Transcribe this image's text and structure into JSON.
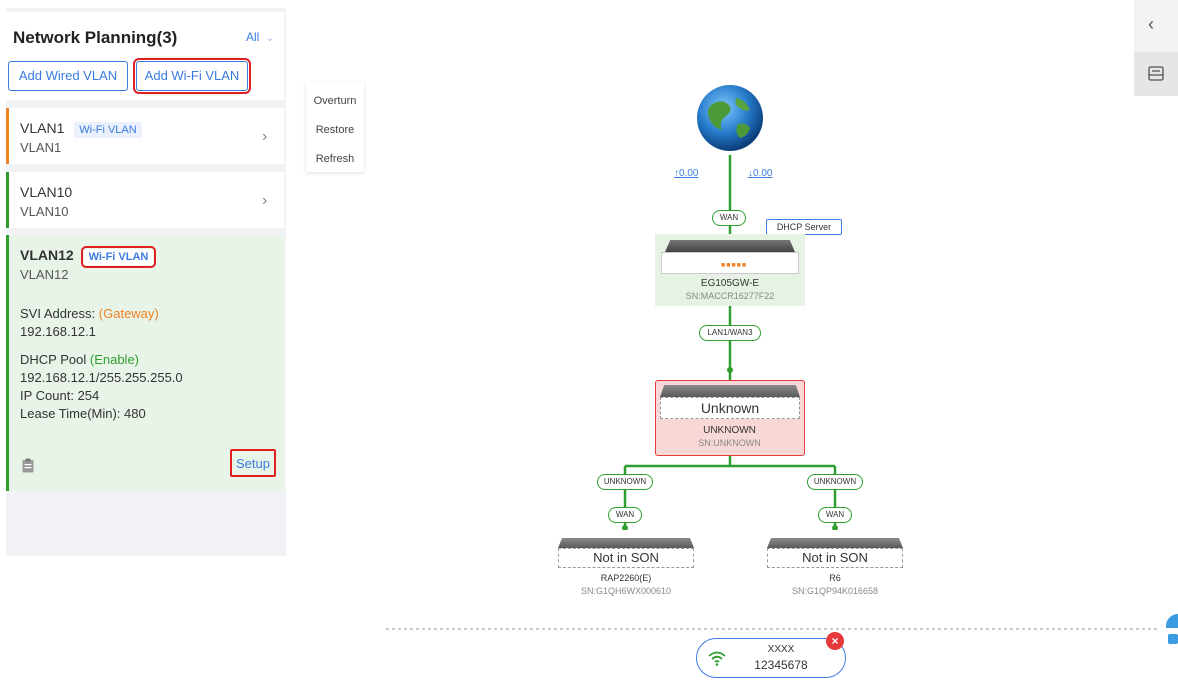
{
  "panel": {
    "title": "Network Planning(3)",
    "filter_label": "All",
    "add_wired_label": "Add Wired VLAN",
    "add_wifi_label": "Add Wi-Fi VLAN"
  },
  "vlans": [
    {
      "name": "VLAN1",
      "tag": "Wi-Fi VLAN",
      "sub": "VLAN1"
    },
    {
      "name": "VLAN10",
      "sub": "VLAN10"
    },
    {
      "name": "VLAN12",
      "tag": "Wi-Fi VLAN",
      "sub": "VLAN12",
      "svi_label": "SVI Address:",
      "svi_role": "(Gateway)",
      "svi_ip": "192.168.12.1",
      "dhcp_label": "DHCP Pool",
      "dhcp_state": "(Enable)",
      "dhcp_range": "192.168.12.1/255.255.255.0",
      "ip_count": "IP Count: 254",
      "lease": "Lease Time(Min): 480",
      "setup_label": "Setup"
    }
  ],
  "toolbar": {
    "overturn": "Overturn",
    "restore": "Restore",
    "refresh": "Refresh"
  },
  "topology": {
    "up_rate": "↑0.00",
    "down_rate": "↓0.00",
    "gateway": {
      "port": "WAN",
      "badge": "DHCP Server",
      "model": "EG105GW-E",
      "sn": "SN:MACCR16277F22"
    },
    "link_port": "LAN1/WAN3",
    "switch": {
      "label": "Unknown",
      "model": "UNKNOWN",
      "sn": "SN:UNKNOWN"
    },
    "ap1": {
      "uplink": "UNKNOWN",
      "port": "WAN",
      "status": "Not in SON",
      "model": "RAP2260(E)",
      "sn": "SN:G1QH6WX000610"
    },
    "ap2": {
      "uplink": "UNKNOWN",
      "port": "WAN",
      "status": "Not in SON",
      "model": "R6",
      "sn": "SN:G1QP94K016658"
    }
  },
  "wifi": {
    "ssid": "XXXX",
    "password": "12345678"
  },
  "colors": {
    "accent": "#3a7be0",
    "highlight": "#e02020",
    "link": "#2e9f2e",
    "warning": "#e5393b"
  },
  "icons": [
    "chevron-left-icon",
    "device-list-icon",
    "clipboard-icon",
    "globe-icon",
    "wifi-icon",
    "close-icon",
    "chevron-right-icon",
    "chevron-down-icon"
  ]
}
